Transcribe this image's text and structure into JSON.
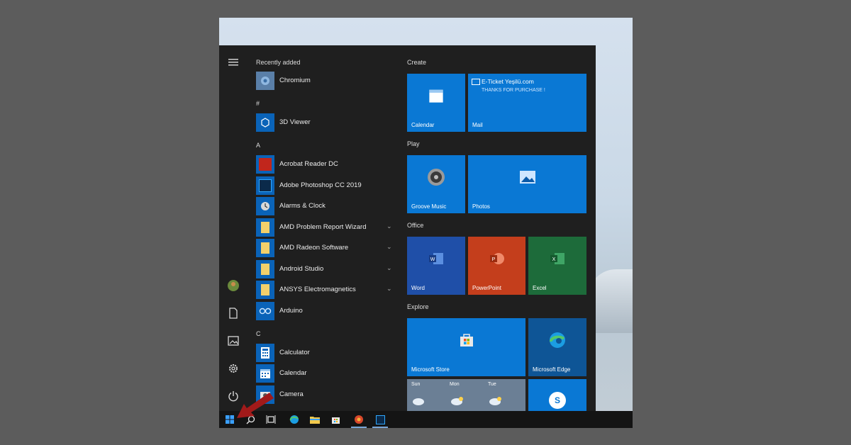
{
  "start_menu": {
    "rail": {
      "menu_icon": "hamburger-menu-icon",
      "items": [
        "user-avatar-icon",
        "documents-icon",
        "pictures-icon",
        "settings-icon",
        "power-icon"
      ]
    },
    "app_list": {
      "sections": [
        {
          "heading": "Recently added",
          "apps": [
            {
              "label": "Chromium",
              "icon": "chromium-icon",
              "color": "#5a7fa8",
              "expandable": false
            }
          ]
        },
        {
          "heading": "#",
          "apps": [
            {
              "label": "3D Viewer",
              "icon": "cube-icon",
              "color": "#0a63b8",
              "expandable": false
            }
          ]
        },
        {
          "heading": "A",
          "apps": [
            {
              "label": "Acrobat Reader DC",
              "icon": "acrobat-icon",
              "color": "#c1261c",
              "expandable": false
            },
            {
              "label": "Adobe Photoshop CC 2019",
              "icon": "photoshop-icon",
              "color": "#0a63b8",
              "expandable": false
            },
            {
              "label": "Alarms & Clock",
              "icon": "clock-icon",
              "color": "#0a63b8",
              "expandable": false
            },
            {
              "label": "AMD Problem Report Wizard",
              "icon": "folder-icon",
              "color": "#0a63b8",
              "expandable": true
            },
            {
              "label": "AMD Radeon Software",
              "icon": "folder-icon",
              "color": "#0a63b8",
              "expandable": true
            },
            {
              "label": "Android Studio",
              "icon": "folder-icon",
              "color": "#0a63b8",
              "expandable": true
            },
            {
              "label": "ANSYS Electromagnetics",
              "icon": "folder-icon",
              "color": "#0a63b8",
              "expandable": true
            },
            {
              "label": "Arduino",
              "icon": "arduino-icon",
              "color": "#0a63b8",
              "expandable": false
            }
          ]
        },
        {
          "heading": "C",
          "apps": [
            {
              "label": "Calculator",
              "icon": "calculator-icon",
              "color": "#0a63b8",
              "expandable": false
            },
            {
              "label": "Calendar",
              "icon": "calendar-icon",
              "color": "#0a63b8",
              "expandable": false
            },
            {
              "label": "Camera",
              "icon": "camera-icon",
              "color": "#0a63b8",
              "expandable": false
            }
          ]
        }
      ]
    },
    "tile_groups": {
      "create": {
        "heading": "Create",
        "calendar_tile": {
          "label": "Calendar",
          "icon": "calendar-icon"
        },
        "mail_tile": {
          "label": "Mail",
          "sender": "E-Ticket Yeşilü.com",
          "message": "THANKS FOR PURCHASE !",
          "icon": "mail-icon"
        }
      },
      "play": {
        "heading": "Play",
        "groove_tile": {
          "label": "Groove Music",
          "icon": "groove-music-icon"
        },
        "photos_tile": {
          "label": "Photos",
          "icon": "photos-icon"
        }
      },
      "office": {
        "heading": "Office",
        "word_tile": {
          "label": "Word",
          "icon": "word-icon",
          "color": "#1f4fa8"
        },
        "powerpoint_tile": {
          "label": "PowerPoint",
          "icon": "powerpoint-icon",
          "color": "#c43e1c"
        },
        "excel_tile": {
          "label": "Excel",
          "icon": "excel-icon",
          "color": "#1d6b3a"
        }
      },
      "explore": {
        "heading": "Explore",
        "store_tile": {
          "label": "Microsoft Store",
          "icon": "store-icon"
        },
        "edge_tile": {
          "label": "Microsoft Edge",
          "icon": "edge-icon",
          "color": "#0e5596"
        },
        "weather_tile": {
          "days": [
            "Sun",
            "Mon",
            "Tue"
          ],
          "icon": "weather-icon"
        },
        "skype_tile": {
          "icon": "skype-icon"
        }
      }
    }
  },
  "taskbar": {
    "items": [
      "start-button",
      "search-icon",
      "task-view-icon",
      "edge-icon",
      "file-explorer-icon",
      "store-icon",
      "chromium-icon",
      "photoshop-icon"
    ]
  },
  "colors": {
    "accent": "#0a78d4",
    "start_bg": "#1f1f1f",
    "taskbar_bg": "#141414",
    "arrow": "#a11a1a"
  }
}
